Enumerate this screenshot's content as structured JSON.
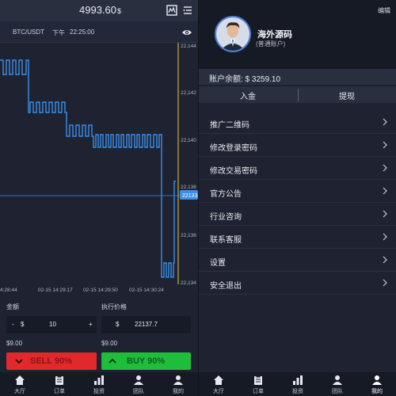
{
  "left": {
    "balance": "4993.60",
    "currency": "$",
    "pair": "BTC/USDT",
    "ampm": "下午",
    "time": "22:25:00",
    "chart_data": {
      "type": "line",
      "x_tick_labels": [
        "4:28:44",
        "02-15 14:29:17",
        "02-15 14:29:50",
        "02-15 14:30:24"
      ],
      "y_tick_labels": [
        "22,144",
        "22,142",
        "22,140",
        "22,138",
        "22,136",
        "22,134"
      ],
      "current_price_label": "22133",
      "ylim": [
        22134,
        22144
      ]
    },
    "amount_label": "金额",
    "exec_price_label": "执行价格",
    "amount_minus": "-",
    "amount_currency": "$",
    "amount_value": "10",
    "amount_plus": "+",
    "price_currency": "$",
    "price_value": "22137.7",
    "amount_hint": "$9.00",
    "price_hint": "$9.00",
    "sell_label": "SELL 90%",
    "buy_label": "BUY 90%",
    "tabs": [
      "大厅",
      "订单",
      "投资",
      "团队",
      "我的"
    ]
  },
  "right": {
    "edit": "编辑",
    "username": "海外源码",
    "account_type": "(普通账户)",
    "balance_text": "账户余额: $ 3259.10",
    "deposit": "入金",
    "withdraw": "提现",
    "menu": [
      "推广二维码",
      "修改登录密码",
      "修改交易密码",
      "官方公告",
      "行业咨询",
      "联系客服",
      "设置",
      "安全退出"
    ],
    "tabs": [
      "大厅",
      "订单",
      "投资",
      "团队",
      "我的"
    ]
  },
  "colors": {
    "accent": "#3b8ee6",
    "sell": "#e0292a",
    "buy": "#1ebe3b",
    "price_line": "#e8c94a"
  }
}
